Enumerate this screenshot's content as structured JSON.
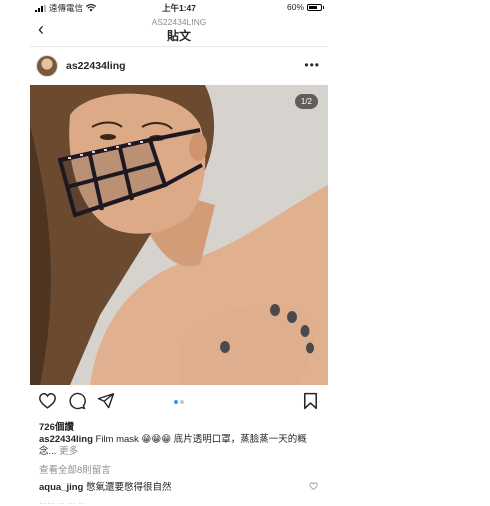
{
  "status_bar": {
    "carrier": "遠傳電信",
    "time": "上午1:47",
    "battery": "60%"
  },
  "nav": {
    "back_glyph": "‹",
    "subtitle": "AS22434LING",
    "title": "貼文"
  },
  "post": {
    "username": "as22434ling",
    "more_glyph": "•••",
    "image_counter": "1/2",
    "likes": "726個讚",
    "caption_user": "as22434ling",
    "caption_text": "Film mask 😁😁😁 底片透明口罩，蒸臉蒸一天的概念...",
    "caption_more": "更多",
    "view_all_comments": "查看全部8則留言",
    "comment_user": "aqua_jing",
    "comment_text": "憋氣還要憋得很自然",
    "peek_text": "…… … … …"
  },
  "colors": {
    "active_dot": "#3897f0",
    "inactive_dot": "#c7c7c7"
  }
}
